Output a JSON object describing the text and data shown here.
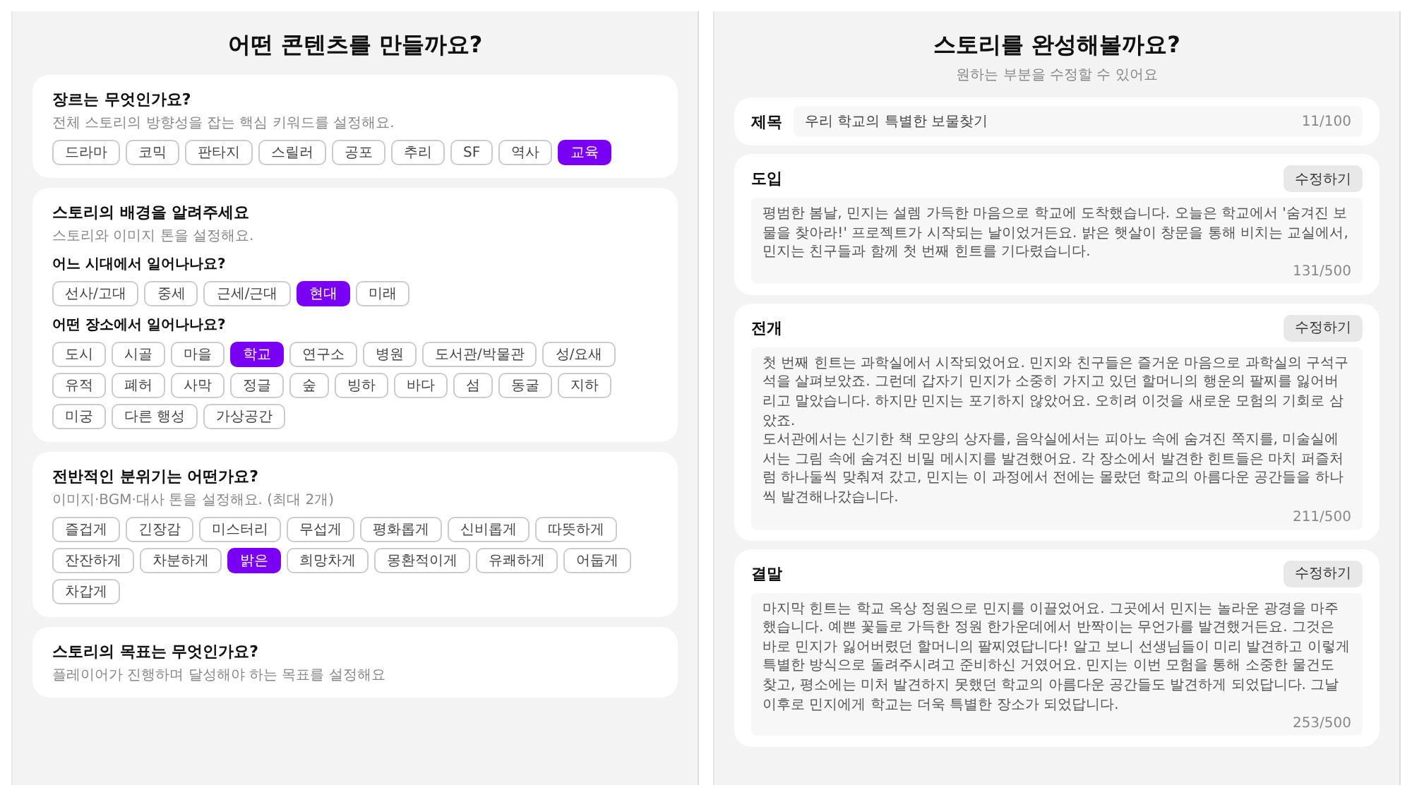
{
  "left": {
    "title": "어떤 콘텐츠를 만들까요?",
    "sections": [
      {
        "title": "장르는 무엇인가요?",
        "subtitle": "전체 스토리의 방향성을 잡는 핵심 키워드를 설정해요.",
        "groups": [
          {
            "chips": [
              {
                "label": "드라마",
                "selected": false
              },
              {
                "label": "코믹",
                "selected": false
              },
              {
                "label": "판타지",
                "selected": false
              },
              {
                "label": "스릴러",
                "selected": false
              },
              {
                "label": "공포",
                "selected": false
              },
              {
                "label": "추리",
                "selected": false
              },
              {
                "label": "SF",
                "selected": false
              },
              {
                "label": "역사",
                "selected": false
              },
              {
                "label": "교육",
                "selected": true
              }
            ]
          }
        ]
      },
      {
        "title": "스토리의 배경을 알려주세요",
        "subtitle": "스토리와 이미지 톤을 설정해요.",
        "groups": [
          {
            "question": "어느 시대에서 일어나나요?",
            "chips": [
              {
                "label": "선사/고대",
                "selected": false
              },
              {
                "label": "중세",
                "selected": false
              },
              {
                "label": "근세/근대",
                "selected": false
              },
              {
                "label": "현대",
                "selected": true
              },
              {
                "label": "미래",
                "selected": false
              }
            ]
          },
          {
            "question": "어떤 장소에서 일어나나요?",
            "chips": [
              {
                "label": "도시",
                "selected": false
              },
              {
                "label": "시골",
                "selected": false
              },
              {
                "label": "마을",
                "selected": false
              },
              {
                "label": "학교",
                "selected": true
              },
              {
                "label": "연구소",
                "selected": false
              },
              {
                "label": "병원",
                "selected": false
              },
              {
                "label": "도서관/박물관",
                "selected": false
              },
              {
                "label": "성/요새",
                "selected": false
              },
              {
                "label": "유적",
                "selected": false
              },
              {
                "label": "폐허",
                "selected": false
              },
              {
                "label": "사막",
                "selected": false
              },
              {
                "label": "정글",
                "selected": false
              },
              {
                "label": "숲",
                "selected": false
              },
              {
                "label": "빙하",
                "selected": false
              },
              {
                "label": "바다",
                "selected": false
              },
              {
                "label": "섬",
                "selected": false
              },
              {
                "label": "동굴",
                "selected": false
              },
              {
                "label": "지하",
                "selected": false
              },
              {
                "label": "미궁",
                "selected": false
              },
              {
                "label": "다른 행성",
                "selected": false
              },
              {
                "label": "가상공간",
                "selected": false
              }
            ]
          }
        ]
      },
      {
        "title": "전반적인 분위기는 어떤가요?",
        "subtitle": "이미지·BGM·대사 톤을 설정해요. (최대 2개)",
        "groups": [
          {
            "chips": [
              {
                "label": "즐겁게",
                "selected": false
              },
              {
                "label": "긴장감",
                "selected": false
              },
              {
                "label": "미스터리",
                "selected": false
              },
              {
                "label": "무섭게",
                "selected": false
              },
              {
                "label": "평화롭게",
                "selected": false
              },
              {
                "label": "신비롭게",
                "selected": false
              },
              {
                "label": "따뜻하게",
                "selected": false
              },
              {
                "label": "잔잔하게",
                "selected": false
              },
              {
                "label": "차분하게",
                "selected": false
              },
              {
                "label": "밝은",
                "selected": true
              },
              {
                "label": "희망차게",
                "selected": false
              },
              {
                "label": "몽환적이게",
                "selected": false
              },
              {
                "label": "유쾌하게",
                "selected": false
              },
              {
                "label": "어둡게",
                "selected": false
              },
              {
                "label": "차갑게",
                "selected": false
              }
            ]
          }
        ]
      },
      {
        "title": "스토리의 목표는 무엇인가요?",
        "subtitle": "플레이어가 진행하며 달성해야 하는 목표를 설정해요"
      }
    ]
  },
  "right": {
    "title": "스토리를 완성해볼까요?",
    "subtitle": "원하는 부분을 수정할 수 있어요",
    "title_field": {
      "label": "제목",
      "value": "우리 학교의 특별한 보물찾기",
      "count": "11/100"
    },
    "parts": [
      {
        "label": "도입",
        "button": "수정하기",
        "text": "평범한 봄날, 민지는 설렘 가득한 마음으로 학교에 도착했습니다. 오늘은 학교에서 '숨겨진 보물을 찾아라!' 프로젝트가 시작되는 날이었거든요. 밝은 햇살이 창문을 통해 비치는 교실에서, 민지는 친구들과 함께 첫 번째 힌트를 기다렸습니다.",
        "count": "131/500"
      },
      {
        "label": "전개",
        "button": "수정하기",
        "text": "첫 번째 힌트는 과학실에서 시작되었어요. 민지와 친구들은 즐거운 마음으로 과학실의 구석구석을 살펴보았죠. 그런데 갑자기 민지가 소중히 가지고 있던 할머니의 행운의 팔찌를 잃어버리고 말았습니다. 하지만 민지는 포기하지 않았어요. 오히려 이것을 새로운 모험의 기회로 삼았죠.\n도서관에서는 신기한 책 모양의 상자를, 음악실에서는 피아노 속에 숨겨진 쪽지를, 미술실에서는 그림 속에 숨겨진 비밀 메시지를 발견했어요. 각 장소에서 발견한 힌트들은 마치 퍼즐처럼 하나둘씩 맞춰져 갔고, 민지는 이 과정에서 전에는 몰랐던 학교의 아름다운 공간들을 하나씩 발견해나갔습니다.",
        "count": "211/500"
      },
      {
        "label": "결말",
        "button": "수정하기",
        "text": "마지막 힌트는 학교 옥상 정원으로 민지를 이끌었어요. 그곳에서 민지는 놀라운 광경을 마주했습니다. 예쁜 꽃들로 가득한 정원 한가운데에서 반짝이는 무언가를 발견했거든요. 그것은 바로 민지가 잃어버렸던 할머니의 팔찌였답니다! 알고 보니 선생님들이 미리 발견하고 이렇게 특별한 방식으로 돌려주시려고 준비하신 거였어요. 민지는 이번 모험을 통해 소중한 물건도 찾고, 평소에는 미처 발견하지 못했던 학교의 아름다운 공간들도 발견하게 되었답니다. 그날 이후로 민지에게 학교는 더욱 특별한 장소가 되었답니다.",
        "count": "253/500"
      }
    ]
  }
}
